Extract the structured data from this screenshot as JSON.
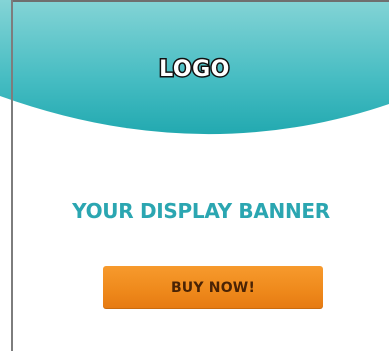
{
  "logo": {
    "text": "LOGO"
  },
  "headline": {
    "text": "YOUR DISPLAY BANNER"
  },
  "cta": {
    "label": "BUY NOW!"
  },
  "colors": {
    "teal_light": "#7fd1d3",
    "teal_dark": "#25aab1",
    "headline": "#2ba6b1",
    "button_top": "#f79a2d",
    "button_bottom": "#e67a12",
    "button_text": "#4a2305",
    "border": "#7d7d7d"
  }
}
